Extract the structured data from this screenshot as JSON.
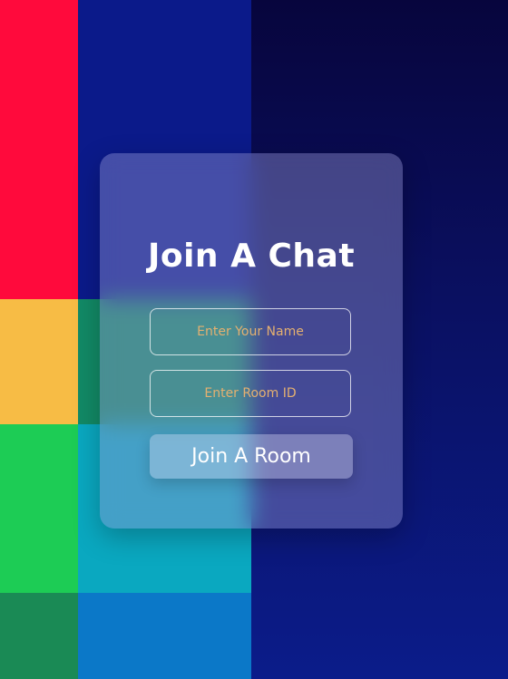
{
  "join_card": {
    "title": "Join A Chat",
    "name_field": {
      "placeholder": "Enter Your Name",
      "value": ""
    },
    "room_field": {
      "placeholder": "Enter Room ID",
      "value": ""
    },
    "join_button_label": "Join A Room"
  },
  "colors": {
    "background_blocks": [
      "#ff0a3c",
      "#f7bc45",
      "#1dcc55",
      "#1a8a55",
      "#0b1a8a",
      "#128a66",
      "#0aa8c0",
      "#0b78c8",
      "#07053d"
    ],
    "placeholder_text": "#e4b070",
    "title_text": "#ffffff"
  }
}
